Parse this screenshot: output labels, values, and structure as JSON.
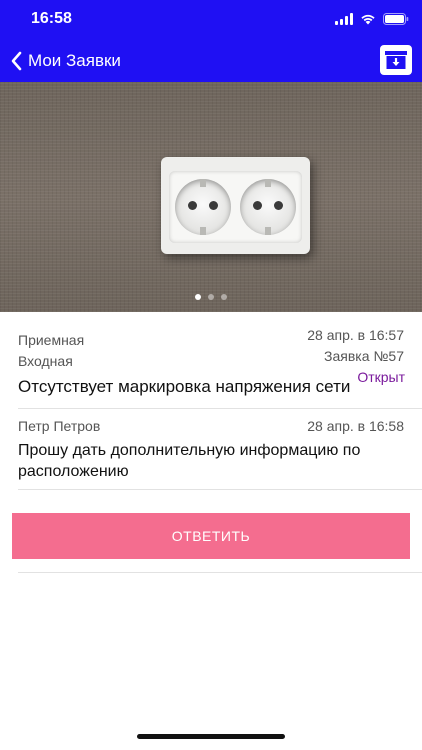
{
  "status_bar": {
    "time": "16:58"
  },
  "nav": {
    "back_label": "Мои Заявки",
    "archive_icon": "archive-download-icon"
  },
  "photo": {
    "slide_count": 3,
    "active_slide": 0
  },
  "request": {
    "recipient": "Приемная",
    "date": "28 апр. в 16:57",
    "folder": "Входная",
    "number": "Заявка №57",
    "status": "Открыт",
    "subject": "Отсутствует маркировка напряжения сети"
  },
  "comment": {
    "author": "Петр Петров",
    "date": "28 апр. в 16:58",
    "text": "Прошу дать дополнительную информацию по расположению"
  },
  "actions": {
    "reply_label": "ОТВЕТИТЬ"
  },
  "colors": {
    "header": "#1f10f3",
    "reply_button": "#f46d8f",
    "status": "#7a1a9c"
  }
}
